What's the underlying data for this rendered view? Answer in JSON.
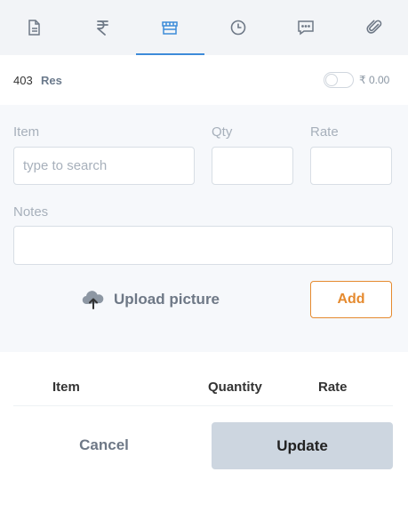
{
  "tabs": [
    {
      "icon": "document-icon",
      "active": false
    },
    {
      "icon": "rupee-icon",
      "active": false
    },
    {
      "icon": "store-icon",
      "active": true
    },
    {
      "icon": "clock-icon",
      "active": false
    },
    {
      "icon": "chat-icon",
      "active": false
    },
    {
      "icon": "paperclip-icon",
      "active": false
    }
  ],
  "order": {
    "number": "403",
    "type": "Res",
    "amount": "₹ 0.00",
    "toggle_on": false
  },
  "form": {
    "item_label": "Item",
    "item_placeholder": "type to search",
    "qty_label": "Qty",
    "rate_label": "Rate",
    "notes_label": "Notes",
    "upload_label": "Upload picture",
    "add_label": "Add"
  },
  "table": {
    "columns": [
      "Item",
      "Quantity",
      "Rate"
    ]
  },
  "actions": {
    "cancel": "Cancel",
    "update": "Update"
  },
  "colors": {
    "accent": "#3d8bd9",
    "add_button": "#e58a2f",
    "update_button_bg": "#cdd6e0"
  }
}
